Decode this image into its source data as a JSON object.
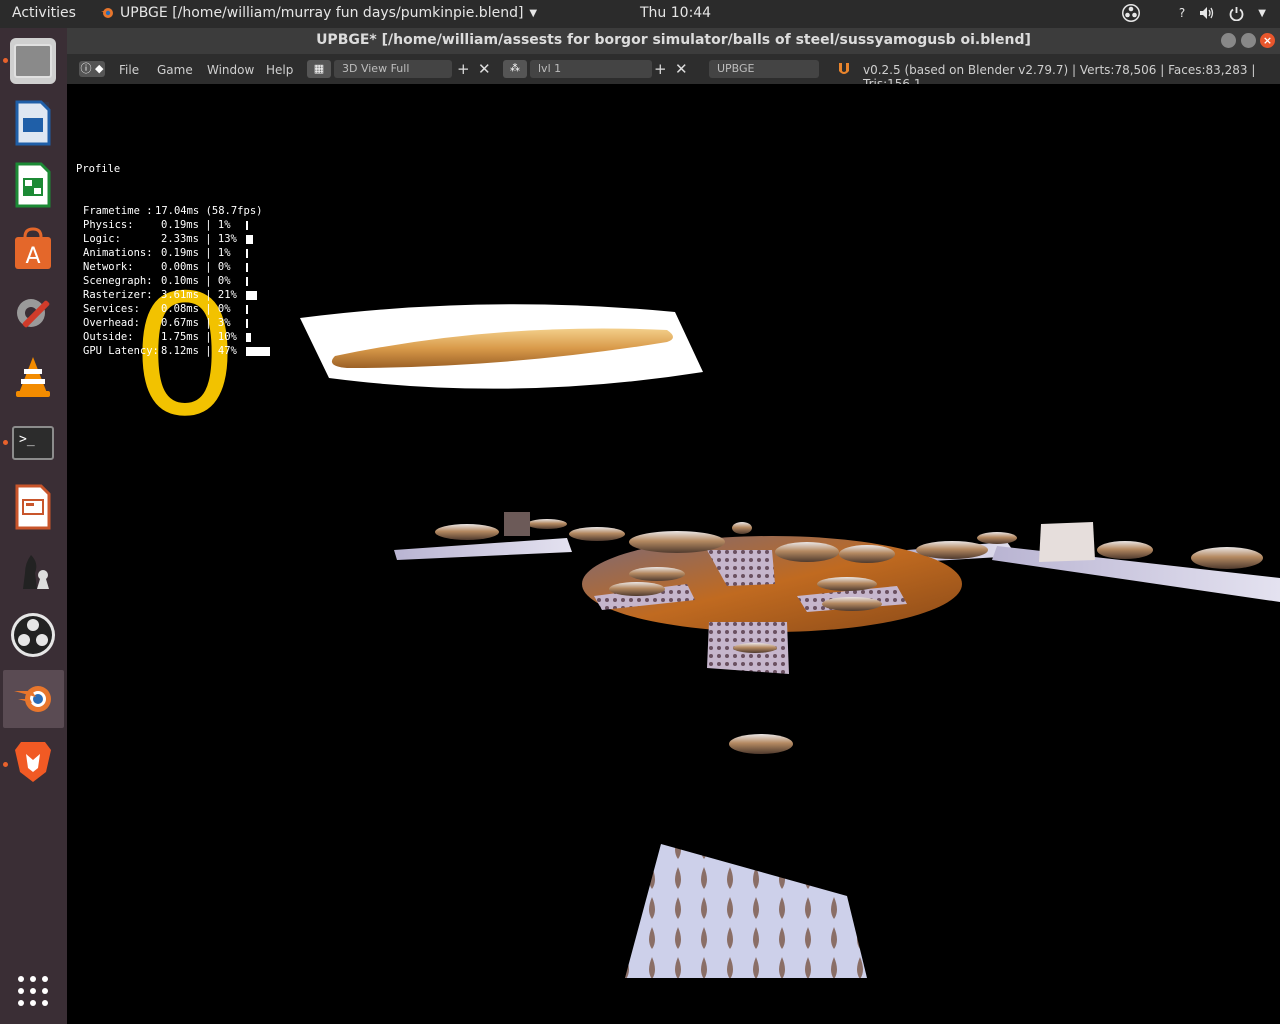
{
  "topbar": {
    "activities": "Activities",
    "app_title": "UPBGE [/home/william/murray fun days/pumkinpie.blend]",
    "clock": "Thu 10:44",
    "help_icon": "?"
  },
  "window": {
    "title": "UPBGE* [/home/william/assests for borgor simulator/balls of steel/sussyamogusb oi.blend]"
  },
  "menu": {
    "file": "File",
    "game": "Game",
    "window": "Window",
    "help": "Help",
    "screen_layout": "3D View Full",
    "scene": "lvl 1",
    "engine": "UPBGE",
    "stats": "v0.2.5 (based on Blender v2.79.7)  | Verts:78,506 | Faces:83,283 | Tris:156,1"
  },
  "profile": {
    "heading": "Profile",
    "rows": [
      {
        "label": "Frametime :",
        "value": "17.04ms (58.7fps)",
        "pct": "",
        "fraction": 0
      },
      {
        "label": "Physics:",
        "value": "0.19ms",
        "pct": "1%",
        "fraction": 0.01
      },
      {
        "label": "Logic:",
        "value": "2.33ms",
        "pct": "13%",
        "fraction": 0.13
      },
      {
        "label": "Animations:",
        "value": "0.19ms",
        "pct": "1%",
        "fraction": 0.01
      },
      {
        "label": "Network:",
        "value": "0.00ms",
        "pct": "0%",
        "fraction": 0
      },
      {
        "label": "Scenegraph:",
        "value": "0.10ms",
        "pct": "0%",
        "fraction": 0
      },
      {
        "label": "Rasterizer:",
        "value": "3.61ms",
        "pct": "21%",
        "fraction": 0.21
      },
      {
        "label": "Services:",
        "value": "0.08ms",
        "pct": "0%",
        "fraction": 0
      },
      {
        "label": "Overhead:",
        "value": "0.67ms",
        "pct": "3%",
        "fraction": 0.03
      },
      {
        "label": "Outside:",
        "value": "1.75ms",
        "pct": "10%",
        "fraction": 0.1
      },
      {
        "label": "GPU Latency:",
        "value": "8.12ms",
        "pct": "47%",
        "fraction": 0.47
      }
    ]
  },
  "score": "0",
  "icons": {
    "launcher": [
      "files-icon",
      "writer-icon",
      "calc-icon",
      "software-store-icon",
      "settings-icon",
      "vlc-icon",
      "terminal-icon",
      "impress-icon",
      "chess-icon",
      "obs-icon",
      "blender-icon",
      "brave-icon",
      "apps-grid-icon"
    ]
  },
  "colors": {
    "score": "#f2c200",
    "launcher_bg": "#3a2e35",
    "accent_orange": "#e8622c"
  }
}
